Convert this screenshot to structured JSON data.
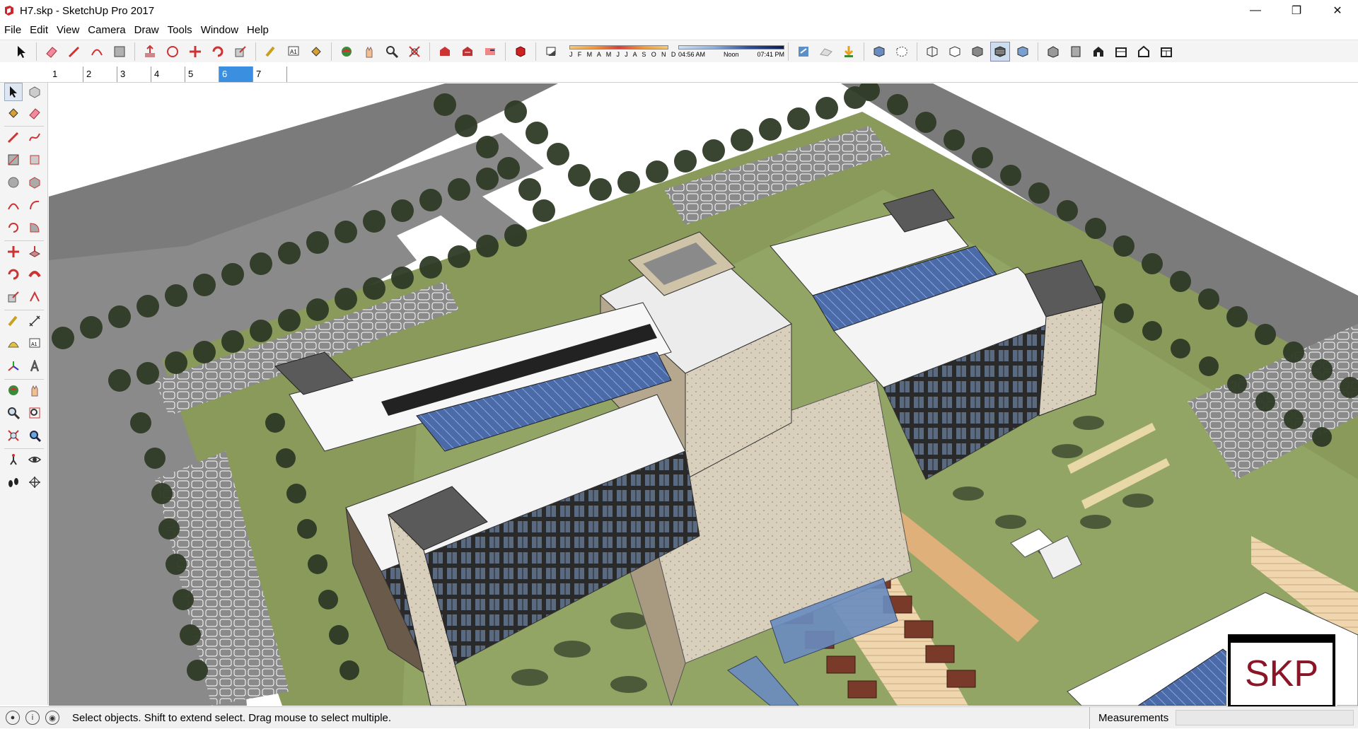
{
  "window": {
    "title": "H7.skp - SketchUp Pro 2017",
    "minimize": "—",
    "maximize": "❐",
    "close": "✕"
  },
  "menu": [
    "File",
    "Edit",
    "View",
    "Camera",
    "Draw",
    "Tools",
    "Window",
    "Help"
  ],
  "shadow": {
    "months": "J F M A M J J A S O N D",
    "time_start": "04:56 AM",
    "time_mid": "Noon",
    "time_end": "07:41 PM"
  },
  "scenes": {
    "tabs": [
      "1",
      "2",
      "3",
      "4",
      "5",
      "6",
      "7"
    ],
    "active_index": 5
  },
  "status": {
    "message": "Select objects. Shift to extend select. Drag mouse to select multiple.",
    "measurements_label": "Measurements",
    "measurements_value": ""
  },
  "badge": {
    "text": "SKP"
  },
  "colors": {
    "toolbar_bg": "#f4f4f4",
    "scene_active": "#3b8fe0",
    "badge_red": "#8b1527",
    "grass": "#8a9a5b",
    "road": "#7b7b7b",
    "glass": "#4a6aa8"
  }
}
